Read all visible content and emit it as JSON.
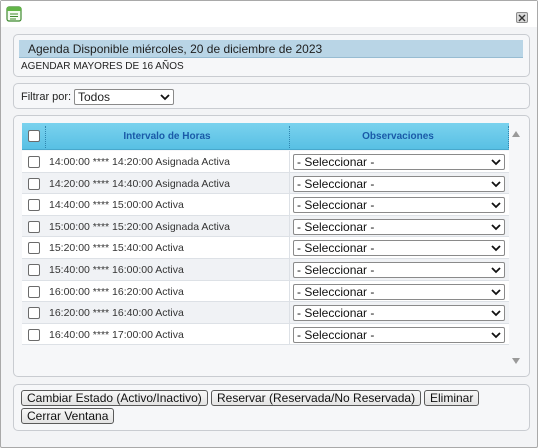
{
  "header": {
    "title": "Agenda Disponible miércoles, 20 de diciembre de 2023",
    "subtitle": "AGENDAR MAYORES DE 16 AÑOS"
  },
  "filter": {
    "label": "Filtrar por:",
    "selected": "Todos"
  },
  "grid": {
    "columns": [
      "Intervalo de Horas",
      "Observaciones"
    ],
    "rows": [
      {
        "interval": "14:00:00 **** 14:20:00 Asignada Activa",
        "observation": "- Seleccionar -"
      },
      {
        "interval": "14:20:00 **** 14:40:00 Asignada Activa",
        "observation": "- Seleccionar -"
      },
      {
        "interval": "14:40:00 **** 15:00:00 Activa",
        "observation": "- Seleccionar -"
      },
      {
        "interval": "15:00:00 **** 15:20:00 Asignada Activa",
        "observation": "- Seleccionar -"
      },
      {
        "interval": "15:20:00 **** 15:40:00 Activa",
        "observation": "- Seleccionar -"
      },
      {
        "interval": "15:40:00 **** 16:00:00 Activa",
        "observation": "- Seleccionar -"
      },
      {
        "interval": "16:00:00 **** 16:20:00 Activa",
        "observation": "- Seleccionar -"
      },
      {
        "interval": "16:20:00 **** 16:40:00 Activa",
        "observation": "- Seleccionar -"
      },
      {
        "interval": "16:40:00 **** 17:00:00 Activa",
        "observation": "- Seleccionar -"
      }
    ]
  },
  "actions": {
    "change_state": "Cambiar Estado (Activo/Inactivo)",
    "reserve": "Reservar (Reservada/No Reservada)",
    "delete": "Eliminar",
    "close": "Cerrar Ventana"
  },
  "icons": {
    "app": "form-window-icon",
    "close": "close-icon"
  },
  "colors": {
    "header_band": "#b9d5e6",
    "grid_header": "#5ec4e7",
    "grid_header_text": "#1a5aa8"
  }
}
